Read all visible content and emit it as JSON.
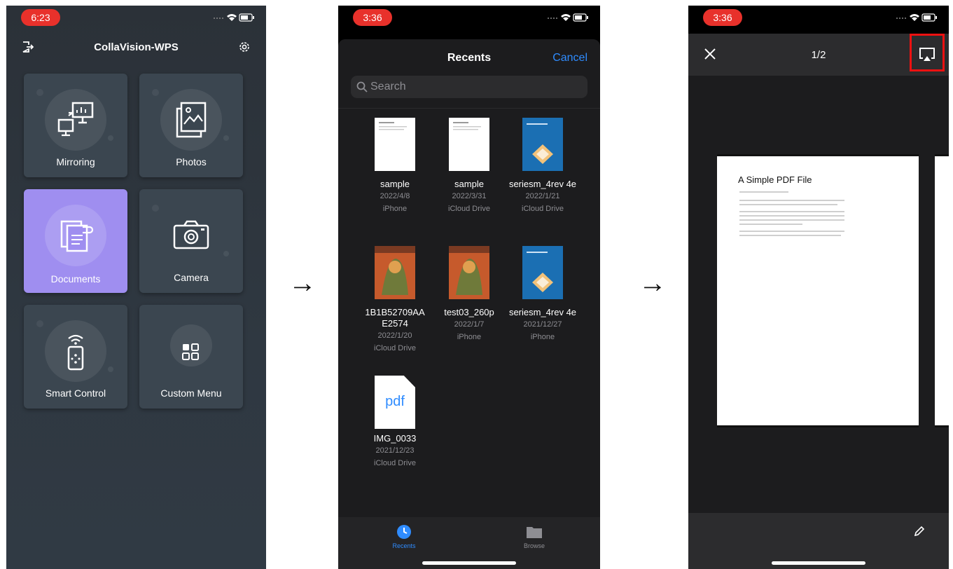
{
  "arrows": [
    "→",
    "→"
  ],
  "phone1": {
    "time": "6:23",
    "title": "CollaVision-WPS",
    "tiles": [
      {
        "label": "Mirroring",
        "icon": "mirroring-icon"
      },
      {
        "label": "Photos",
        "icon": "photos-icon"
      },
      {
        "label": "Documents",
        "icon": "documents-icon",
        "active": true
      },
      {
        "label": "Camera",
        "icon": "camera-icon"
      },
      {
        "label": "Smart Control",
        "icon": "remote-control-icon"
      },
      {
        "label": "Custom Menu",
        "icon": "grid-menu-icon"
      }
    ],
    "colors": {
      "active_tile": "#9f8ef0",
      "tile": "#3b4650"
    }
  },
  "phone2": {
    "time": "3:36",
    "title": "Recents",
    "cancel_label": "Cancel",
    "search_placeholder": "Search",
    "files": [
      {
        "name": "sample",
        "date": "2022/4/8",
        "location": "iPhone",
        "thumb": "doc"
      },
      {
        "name": "sample",
        "date": "2022/3/31",
        "location": "iCloud Drive",
        "thumb": "doc"
      },
      {
        "name": "seriesm_4rev 4e",
        "date": "2022/1/21",
        "location": "iCloud Drive",
        "thumb": "blue"
      },
      {
        "name": "1B1B52709AA E2574",
        "date": "2022/1/20",
        "location": "iCloud Drive",
        "thumb": "art"
      },
      {
        "name": "test03_260p",
        "date": "2022/1/7",
        "location": "iPhone",
        "thumb": "art"
      },
      {
        "name": "seriesm_4rev 4e",
        "date": "2021/12/27",
        "location": "iPhone",
        "thumb": "blue"
      },
      {
        "name": "IMG_0033",
        "date": "2021/12/23",
        "location": "iCloud Drive",
        "thumb": "pdf"
      }
    ],
    "pdf_thumb_label": "pdf",
    "tabs": [
      {
        "label": "Recents",
        "icon": "clock-icon",
        "active": true
      },
      {
        "label": "Browse",
        "icon": "folder-icon"
      }
    ],
    "colors": {
      "accent": "#2f8cff"
    }
  },
  "phone3": {
    "time": "3:36",
    "page_indicator": "1/2",
    "pdf_title": "A Simple PDF File",
    "highlight_color": "#e11111"
  }
}
